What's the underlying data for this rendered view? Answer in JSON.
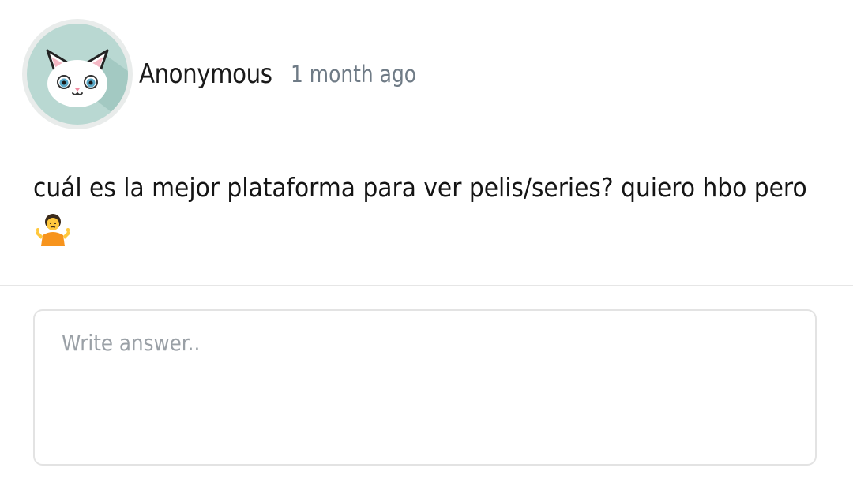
{
  "post": {
    "author": "Anonymous",
    "timestamp": "1 month ago",
    "avatar_icon": "cat-avatar-icon",
    "question_text": "cuál es la mejor plataforma para ver pelis/series? quiero hbo pero",
    "emoji_icon": "person-shrugging-icon"
  },
  "answer": {
    "placeholder": "Write answer.."
  },
  "colors": {
    "avatar_bg": "#b9d8d2",
    "avatar_ring": "#e9eceb",
    "timestamp": "#6f7b86",
    "divider": "#e6e6e6",
    "input_border": "#e3e3e3",
    "placeholder": "#9aa0a6"
  }
}
